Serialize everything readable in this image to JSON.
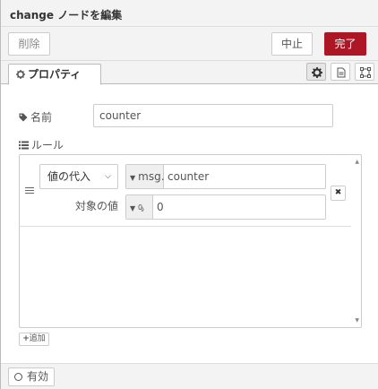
{
  "header": {
    "title": "change ノードを編集"
  },
  "toolbar": {
    "delete_label": "削除",
    "cancel_label": "中止",
    "done_label": "完了"
  },
  "tabs": {
    "properties_label": "プロパティ",
    "icons": [
      "gear-icon",
      "description-icon",
      "appearance-icon"
    ]
  },
  "form": {
    "name_label": "名前",
    "name_value": "counter",
    "rules_label": "ルール"
  },
  "rule": {
    "action": "値の代入",
    "property_type": "msg.",
    "property_value": "counter",
    "target_label": "対象の値",
    "value_type": "0",
    "value_type_icon": "number-icon",
    "value": "0"
  },
  "add_label": "追加",
  "footer": {
    "enabled_label": "有効"
  },
  "colors": {
    "accent": "#ad1625",
    "panel": "#f3f3f3"
  }
}
